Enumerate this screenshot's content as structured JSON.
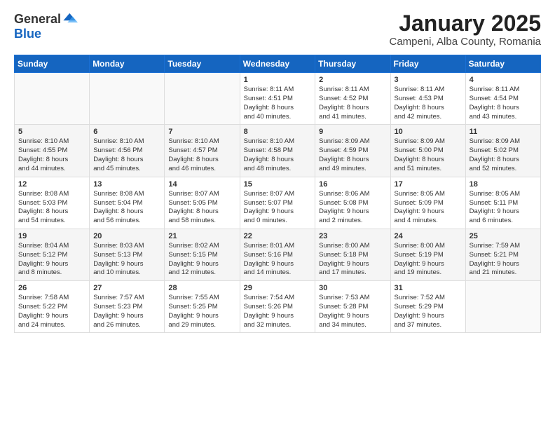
{
  "logo": {
    "general": "General",
    "blue": "Blue"
  },
  "calendar": {
    "title": "January 2025",
    "subtitle": "Campeni, Alba County, Romania",
    "days": [
      "Sunday",
      "Monday",
      "Tuesday",
      "Wednesday",
      "Thursday",
      "Friday",
      "Saturday"
    ],
    "weeks": [
      [
        {
          "num": "",
          "info": ""
        },
        {
          "num": "",
          "info": ""
        },
        {
          "num": "",
          "info": ""
        },
        {
          "num": "1",
          "info": "Sunrise: 8:11 AM\nSunset: 4:51 PM\nDaylight: 8 hours\nand 40 minutes."
        },
        {
          "num": "2",
          "info": "Sunrise: 8:11 AM\nSunset: 4:52 PM\nDaylight: 8 hours\nand 41 minutes."
        },
        {
          "num": "3",
          "info": "Sunrise: 8:11 AM\nSunset: 4:53 PM\nDaylight: 8 hours\nand 42 minutes."
        },
        {
          "num": "4",
          "info": "Sunrise: 8:11 AM\nSunset: 4:54 PM\nDaylight: 8 hours\nand 43 minutes."
        }
      ],
      [
        {
          "num": "5",
          "info": "Sunrise: 8:10 AM\nSunset: 4:55 PM\nDaylight: 8 hours\nand 44 minutes."
        },
        {
          "num": "6",
          "info": "Sunrise: 8:10 AM\nSunset: 4:56 PM\nDaylight: 8 hours\nand 45 minutes."
        },
        {
          "num": "7",
          "info": "Sunrise: 8:10 AM\nSunset: 4:57 PM\nDaylight: 8 hours\nand 46 minutes."
        },
        {
          "num": "8",
          "info": "Sunrise: 8:10 AM\nSunset: 4:58 PM\nDaylight: 8 hours\nand 48 minutes."
        },
        {
          "num": "9",
          "info": "Sunrise: 8:09 AM\nSunset: 4:59 PM\nDaylight: 8 hours\nand 49 minutes."
        },
        {
          "num": "10",
          "info": "Sunrise: 8:09 AM\nSunset: 5:00 PM\nDaylight: 8 hours\nand 51 minutes."
        },
        {
          "num": "11",
          "info": "Sunrise: 8:09 AM\nSunset: 5:02 PM\nDaylight: 8 hours\nand 52 minutes."
        }
      ],
      [
        {
          "num": "12",
          "info": "Sunrise: 8:08 AM\nSunset: 5:03 PM\nDaylight: 8 hours\nand 54 minutes."
        },
        {
          "num": "13",
          "info": "Sunrise: 8:08 AM\nSunset: 5:04 PM\nDaylight: 8 hours\nand 56 minutes."
        },
        {
          "num": "14",
          "info": "Sunrise: 8:07 AM\nSunset: 5:05 PM\nDaylight: 8 hours\nand 58 minutes."
        },
        {
          "num": "15",
          "info": "Sunrise: 8:07 AM\nSunset: 5:07 PM\nDaylight: 9 hours\nand 0 minutes."
        },
        {
          "num": "16",
          "info": "Sunrise: 8:06 AM\nSunset: 5:08 PM\nDaylight: 9 hours\nand 2 minutes."
        },
        {
          "num": "17",
          "info": "Sunrise: 8:05 AM\nSunset: 5:09 PM\nDaylight: 9 hours\nand 4 minutes."
        },
        {
          "num": "18",
          "info": "Sunrise: 8:05 AM\nSunset: 5:11 PM\nDaylight: 9 hours\nand 6 minutes."
        }
      ],
      [
        {
          "num": "19",
          "info": "Sunrise: 8:04 AM\nSunset: 5:12 PM\nDaylight: 9 hours\nand 8 minutes."
        },
        {
          "num": "20",
          "info": "Sunrise: 8:03 AM\nSunset: 5:13 PM\nDaylight: 9 hours\nand 10 minutes."
        },
        {
          "num": "21",
          "info": "Sunrise: 8:02 AM\nSunset: 5:15 PM\nDaylight: 9 hours\nand 12 minutes."
        },
        {
          "num": "22",
          "info": "Sunrise: 8:01 AM\nSunset: 5:16 PM\nDaylight: 9 hours\nand 14 minutes."
        },
        {
          "num": "23",
          "info": "Sunrise: 8:00 AM\nSunset: 5:18 PM\nDaylight: 9 hours\nand 17 minutes."
        },
        {
          "num": "24",
          "info": "Sunrise: 8:00 AM\nSunset: 5:19 PM\nDaylight: 9 hours\nand 19 minutes."
        },
        {
          "num": "25",
          "info": "Sunrise: 7:59 AM\nSunset: 5:21 PM\nDaylight: 9 hours\nand 21 minutes."
        }
      ],
      [
        {
          "num": "26",
          "info": "Sunrise: 7:58 AM\nSunset: 5:22 PM\nDaylight: 9 hours\nand 24 minutes."
        },
        {
          "num": "27",
          "info": "Sunrise: 7:57 AM\nSunset: 5:23 PM\nDaylight: 9 hours\nand 26 minutes."
        },
        {
          "num": "28",
          "info": "Sunrise: 7:55 AM\nSunset: 5:25 PM\nDaylight: 9 hours\nand 29 minutes."
        },
        {
          "num": "29",
          "info": "Sunrise: 7:54 AM\nSunset: 5:26 PM\nDaylight: 9 hours\nand 32 minutes."
        },
        {
          "num": "30",
          "info": "Sunrise: 7:53 AM\nSunset: 5:28 PM\nDaylight: 9 hours\nand 34 minutes."
        },
        {
          "num": "31",
          "info": "Sunrise: 7:52 AM\nSunset: 5:29 PM\nDaylight: 9 hours\nand 37 minutes."
        },
        {
          "num": "",
          "info": ""
        }
      ]
    ]
  }
}
